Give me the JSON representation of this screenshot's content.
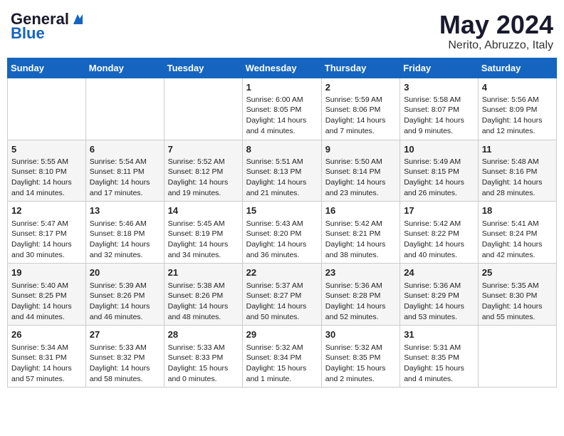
{
  "header": {
    "logo_line1": "General",
    "logo_line2": "Blue",
    "month_title": "May 2024",
    "subtitle": "Nerito, Abruzzo, Italy"
  },
  "days_of_week": [
    "Sunday",
    "Monday",
    "Tuesday",
    "Wednesday",
    "Thursday",
    "Friday",
    "Saturday"
  ],
  "weeks": [
    [
      {
        "day": "",
        "content": ""
      },
      {
        "day": "",
        "content": ""
      },
      {
        "day": "",
        "content": ""
      },
      {
        "day": "1",
        "content": "Sunrise: 6:00 AM\nSunset: 8:05 PM\nDaylight: 14 hours\nand 4 minutes."
      },
      {
        "day": "2",
        "content": "Sunrise: 5:59 AM\nSunset: 8:06 PM\nDaylight: 14 hours\nand 7 minutes."
      },
      {
        "day": "3",
        "content": "Sunrise: 5:58 AM\nSunset: 8:07 PM\nDaylight: 14 hours\nand 9 minutes."
      },
      {
        "day": "4",
        "content": "Sunrise: 5:56 AM\nSunset: 8:09 PM\nDaylight: 14 hours\nand 12 minutes."
      }
    ],
    [
      {
        "day": "5",
        "content": "Sunrise: 5:55 AM\nSunset: 8:10 PM\nDaylight: 14 hours\nand 14 minutes."
      },
      {
        "day": "6",
        "content": "Sunrise: 5:54 AM\nSunset: 8:11 PM\nDaylight: 14 hours\nand 17 minutes."
      },
      {
        "day": "7",
        "content": "Sunrise: 5:52 AM\nSunset: 8:12 PM\nDaylight: 14 hours\nand 19 minutes."
      },
      {
        "day": "8",
        "content": "Sunrise: 5:51 AM\nSunset: 8:13 PM\nDaylight: 14 hours\nand 21 minutes."
      },
      {
        "day": "9",
        "content": "Sunrise: 5:50 AM\nSunset: 8:14 PM\nDaylight: 14 hours\nand 23 minutes."
      },
      {
        "day": "10",
        "content": "Sunrise: 5:49 AM\nSunset: 8:15 PM\nDaylight: 14 hours\nand 26 minutes."
      },
      {
        "day": "11",
        "content": "Sunrise: 5:48 AM\nSunset: 8:16 PM\nDaylight: 14 hours\nand 28 minutes."
      }
    ],
    [
      {
        "day": "12",
        "content": "Sunrise: 5:47 AM\nSunset: 8:17 PM\nDaylight: 14 hours\nand 30 minutes."
      },
      {
        "day": "13",
        "content": "Sunrise: 5:46 AM\nSunset: 8:18 PM\nDaylight: 14 hours\nand 32 minutes."
      },
      {
        "day": "14",
        "content": "Sunrise: 5:45 AM\nSunset: 8:19 PM\nDaylight: 14 hours\nand 34 minutes."
      },
      {
        "day": "15",
        "content": "Sunrise: 5:43 AM\nSunset: 8:20 PM\nDaylight: 14 hours\nand 36 minutes."
      },
      {
        "day": "16",
        "content": "Sunrise: 5:42 AM\nSunset: 8:21 PM\nDaylight: 14 hours\nand 38 minutes."
      },
      {
        "day": "17",
        "content": "Sunrise: 5:42 AM\nSunset: 8:22 PM\nDaylight: 14 hours\nand 40 minutes."
      },
      {
        "day": "18",
        "content": "Sunrise: 5:41 AM\nSunset: 8:24 PM\nDaylight: 14 hours\nand 42 minutes."
      }
    ],
    [
      {
        "day": "19",
        "content": "Sunrise: 5:40 AM\nSunset: 8:25 PM\nDaylight: 14 hours\nand 44 minutes."
      },
      {
        "day": "20",
        "content": "Sunrise: 5:39 AM\nSunset: 8:26 PM\nDaylight: 14 hours\nand 46 minutes."
      },
      {
        "day": "21",
        "content": "Sunrise: 5:38 AM\nSunset: 8:26 PM\nDaylight: 14 hours\nand 48 minutes."
      },
      {
        "day": "22",
        "content": "Sunrise: 5:37 AM\nSunset: 8:27 PM\nDaylight: 14 hours\nand 50 minutes."
      },
      {
        "day": "23",
        "content": "Sunrise: 5:36 AM\nSunset: 8:28 PM\nDaylight: 14 hours\nand 52 minutes."
      },
      {
        "day": "24",
        "content": "Sunrise: 5:36 AM\nSunset: 8:29 PM\nDaylight: 14 hours\nand 53 minutes."
      },
      {
        "day": "25",
        "content": "Sunrise: 5:35 AM\nSunset: 8:30 PM\nDaylight: 14 hours\nand 55 minutes."
      }
    ],
    [
      {
        "day": "26",
        "content": "Sunrise: 5:34 AM\nSunset: 8:31 PM\nDaylight: 14 hours\nand 57 minutes."
      },
      {
        "day": "27",
        "content": "Sunrise: 5:33 AM\nSunset: 8:32 PM\nDaylight: 14 hours\nand 58 minutes."
      },
      {
        "day": "28",
        "content": "Sunrise: 5:33 AM\nSunset: 8:33 PM\nDaylight: 15 hours\nand 0 minutes."
      },
      {
        "day": "29",
        "content": "Sunrise: 5:32 AM\nSunset: 8:34 PM\nDaylight: 15 hours\nand 1 minute."
      },
      {
        "day": "30",
        "content": "Sunrise: 5:32 AM\nSunset: 8:35 PM\nDaylight: 15 hours\nand 2 minutes."
      },
      {
        "day": "31",
        "content": "Sunrise: 5:31 AM\nSunset: 8:35 PM\nDaylight: 15 hours\nand 4 minutes."
      },
      {
        "day": "",
        "content": ""
      }
    ]
  ]
}
